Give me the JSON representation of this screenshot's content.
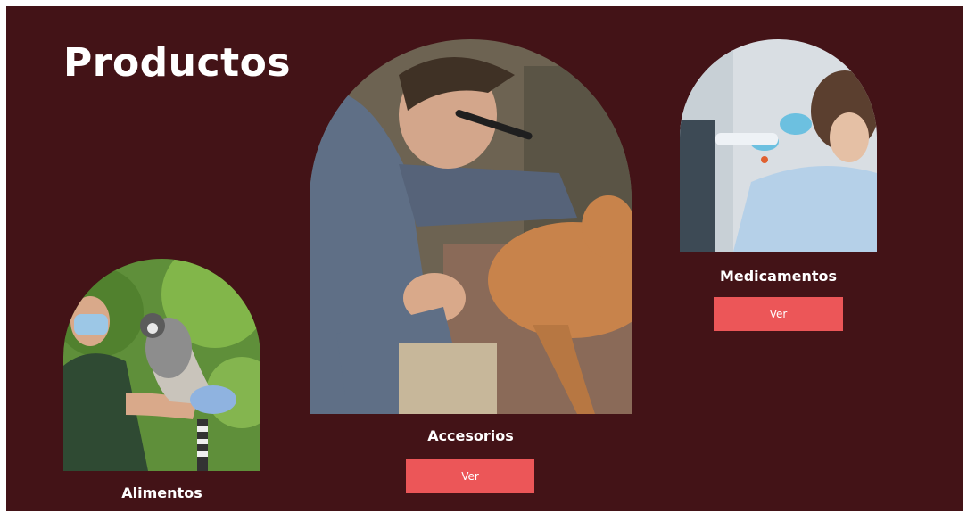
{
  "page": {
    "title": "Productos"
  },
  "products": [
    {
      "name": "Alimentos",
      "button": ""
    },
    {
      "name": "Accesorios",
      "button": "Ver"
    },
    {
      "name": "Medicamentos",
      "button": "Ver"
    }
  ],
  "colors": {
    "background": "#431317",
    "button": "#ec5658",
    "text": "#ffffff"
  }
}
